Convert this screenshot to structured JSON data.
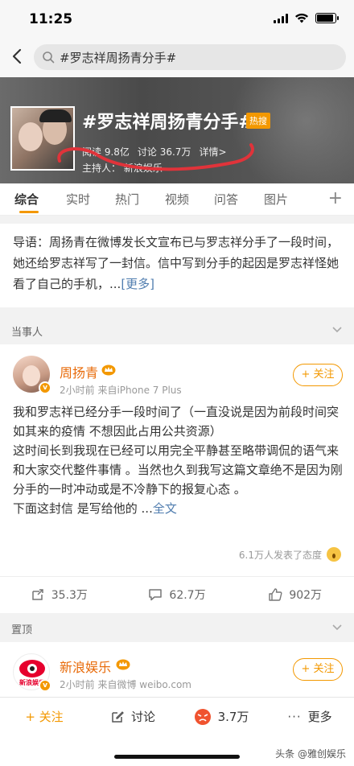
{
  "status": {
    "time": "11:25"
  },
  "search": {
    "query": "#罗志祥周扬青分手#"
  },
  "topic": {
    "title": "#罗志祥周扬青分手#",
    "hot_badge": "热搜",
    "reads": "阅读 9.8亿",
    "discussions": "讨论 36.7万",
    "details": "详情>",
    "host": "主持人：  新浪娱乐"
  },
  "tabs": [
    {
      "label": "综合"
    },
    {
      "label": "实时"
    },
    {
      "label": "热门"
    },
    {
      "label": "视频"
    },
    {
      "label": "问答"
    },
    {
      "label": "图片"
    }
  ],
  "intro": {
    "text": "导语：周扬青在微博发长文宣布已与罗志祥分手了一段时间，她还给罗志祥写了一封信。信中写到分手的起因是罗志祥怪她看了自己的手机，...",
    "more": "[更多]"
  },
  "section1": {
    "label": "当事人"
  },
  "post1": {
    "author": "周扬青",
    "meta": "2小时前  来自iPhone 7 Plus",
    "follow": "+ 关注",
    "text": "我和罗志祥已经分手一段时间了（一直没说是因为前段时间突如其来的疫情 不想因此占用公共资源）\n这时间长到我现在已经可以用完全平静甚至略带调侃的语气来和大家交代整件事情 。当然也久到我写这篇文章绝不是因为刚分手的一时冲动或是不冷静下的报复心态 。\n下面这封信 是写给他的 ...",
    "full": "全文",
    "reacted": "6.1万人发表了态度",
    "reposts": "35.3万",
    "comments": "62.7万",
    "likes": "902万"
  },
  "section2": {
    "label": "置顶"
  },
  "post2": {
    "author": "新浪娱乐",
    "avatar_text": "新浪娱乐",
    "meta": "2小时前  来自微博 weibo.com",
    "follow": "+ 关注"
  },
  "bottom": {
    "follow": "+ 关注",
    "discuss": "讨论",
    "count": "3.7万",
    "more": "更多"
  },
  "watermark": "头条 @雅创娱乐",
  "colors": {
    "accent": "#f39800",
    "link": "#507daf",
    "name": "#e86b0a",
    "annotation": "#e0333a"
  }
}
